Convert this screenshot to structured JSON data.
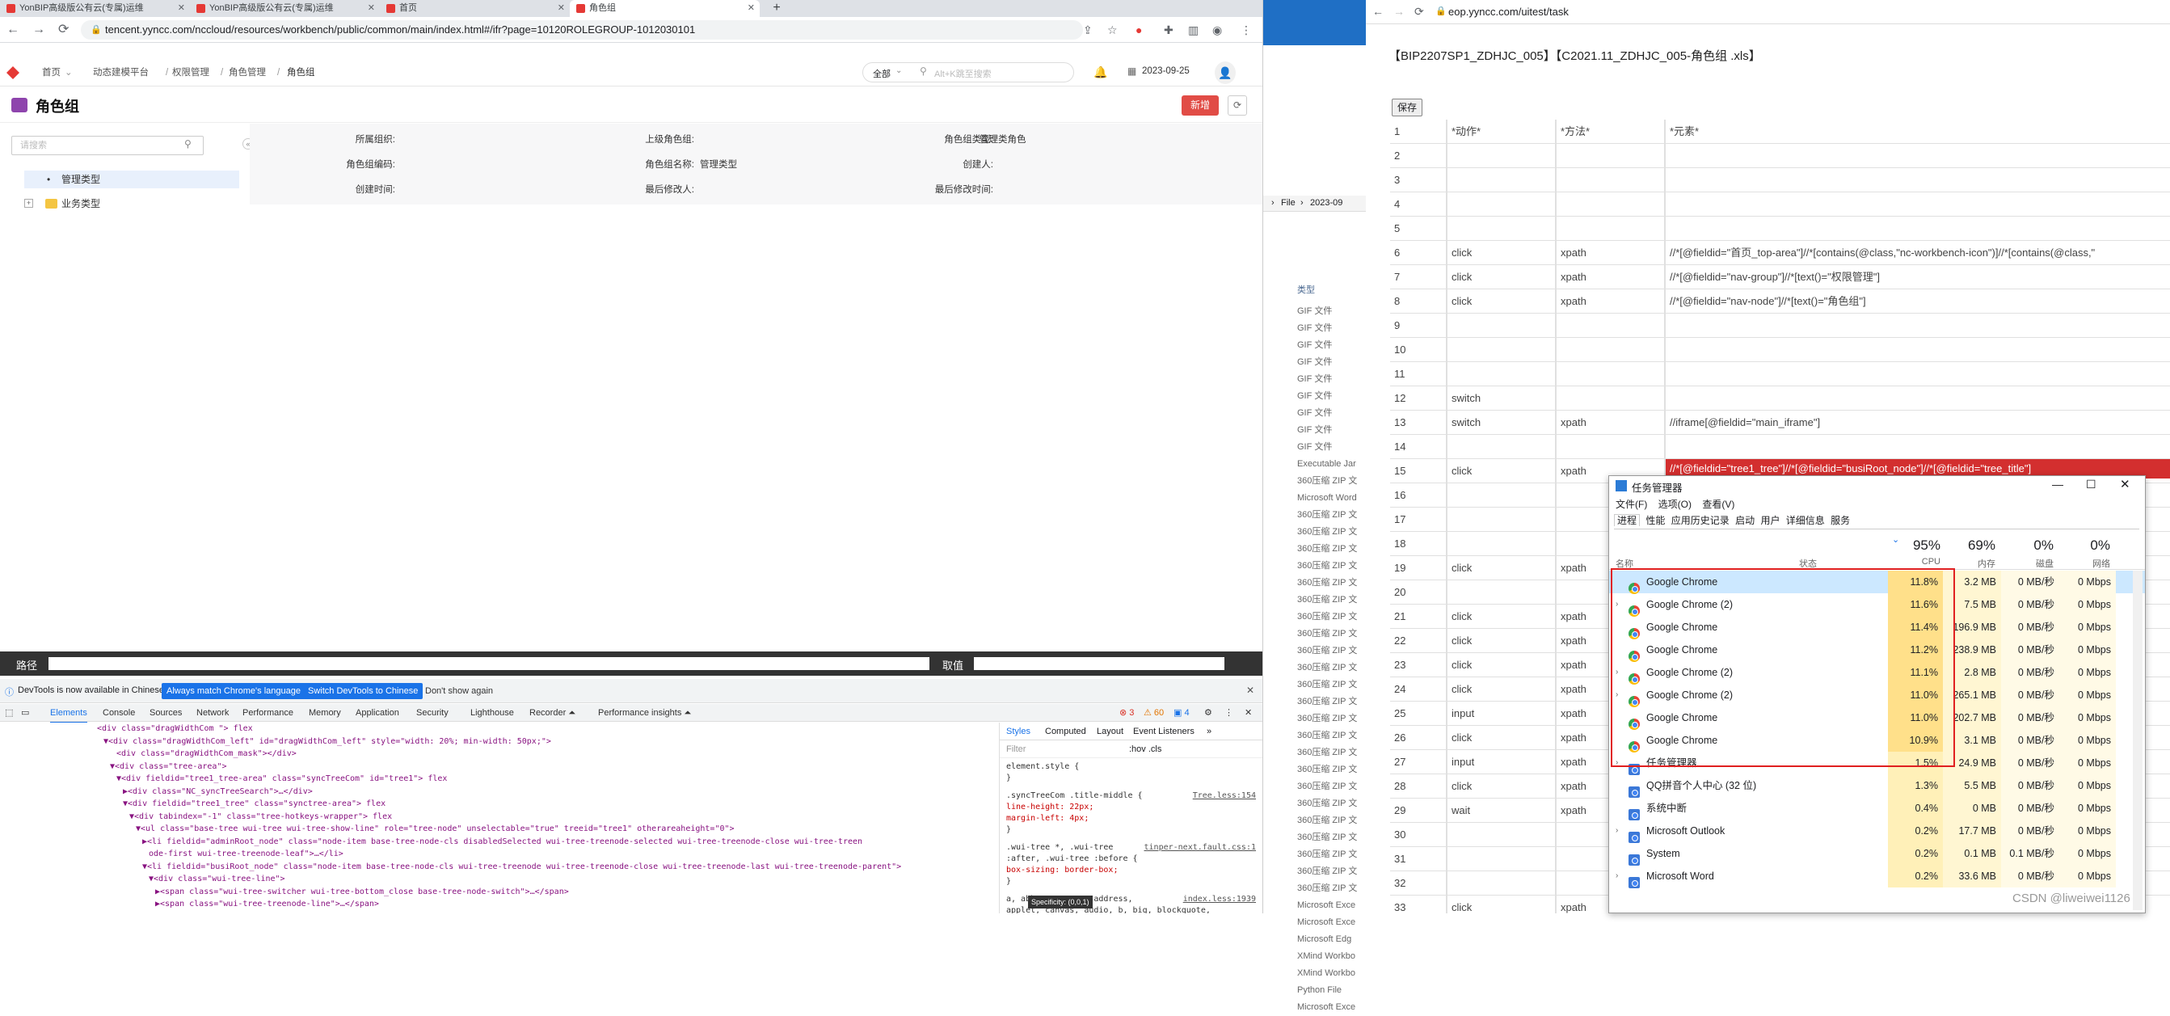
{
  "left_browser": {
    "tabs": [
      {
        "label": "YonBIP高级版公有云(专属)运维",
        "color": "#e53935"
      },
      {
        "label": "YonBIP高级版公有云(专属)运维",
        "color": "#e53935"
      },
      {
        "label": "首页",
        "color": "#e53935"
      },
      {
        "label": "角色组",
        "color": "#e53935"
      }
    ],
    "new_tab": "+",
    "url": "tencent.yyncc.com/nccloud/resources/workbench/public/common/main/index.html#/ifr?page=10120ROLEGROUP-1012030101"
  },
  "app_header": {
    "breadcrumb": [
      "首页",
      "动态建模平台",
      "权限管理",
      "角色管理",
      "角色组"
    ],
    "search_scope": "全部",
    "search_placeholder": "Alt+K跳至搜索",
    "date": "2023-09-25"
  },
  "page": {
    "title": "角色组",
    "new_button": "新增",
    "tree_search_placeholder": "请搜索",
    "tree": [
      {
        "label": "管理类型",
        "selected": true
      },
      {
        "label": "业务类型",
        "selected": false
      }
    ],
    "form": [
      {
        "label": "所属组织:",
        "value": ""
      },
      {
        "label": "上级角色组:",
        "value": ""
      },
      {
        "label": "角色组类型:",
        "value": "管理类角色"
      },
      {
        "label": "角色组编码:",
        "value": ""
      },
      {
        "label": "角色组名称:",
        "value": "管理类型"
      },
      {
        "label": "创建人:",
        "value": ""
      },
      {
        "label": "创建时间:",
        "value": ""
      },
      {
        "label": "最后修改人:",
        "value": ""
      },
      {
        "label": "最后修改时间:",
        "value": ""
      }
    ]
  },
  "bottom_strip": {
    "path_label": "路径",
    "value_label": "取值"
  },
  "devtools": {
    "info": "DevTools is now available in Chinese!",
    "btn_match": "Always match Chrome's language",
    "btn_switch": "Switch DevTools to Chinese",
    "btn_dont": "Don't show again",
    "tabs": [
      "Elements",
      "Console",
      "Sources",
      "Network",
      "Performance",
      "Memory",
      "Application",
      "Security",
      "Lighthouse",
      "Recorder ⏶",
      "Performance insights ⏶"
    ],
    "errors": "3",
    "warnings": "60",
    "issues": "4",
    "code": [
      "<div class=\"dragWidthCom \"> flex",
      "▼<div class=\"dragWidthCom_left\" id=\"dragWidthCom_left\" style=\"width: 20%; min-width: 50px;\">",
      "<div class=\"dragWidthCom_mask\"></div>",
      "▼<div class=\"tree-area\">",
      "▼<div fieldid=\"tree1_tree-area\" class=\"syncTreeCom\" id=\"tree1\"> flex",
      "▶<div class=\"NC_syncTreeSearch\">…</div>",
      "▼<div fieldid=\"tree1_tree\" class=\"synctree-area\"> flex",
      "▼<div tabindex=\"-1\" class=\"tree-hotkeys-wrapper\"> flex",
      "▼<ul class=\"base-tree wui-tree wui-tree-show-line\" role=\"tree-node\" unselectable=\"true\" treeid=\"tree1\" otherareaheight=\"0\">",
      "▶<li fieldid=\"adminRoot_node\" class=\"node-item base-tree-node-cls disabledSelected wui-tree-treenode-selected wui-tree-treenode-close wui-tree-treen",
      "ode-first wui-tree-treenode-leaf\">…</li>",
      "▼<li fieldid=\"busiRoot_node\" class=\"node-item base-tree-node-cls wui-tree-treenode wui-tree-treenode-close wui-tree-treenode-last wui-tree-treenode-parent\">",
      "▼<div class=\"wui-tree-line\">",
      "▶<span class=\"wui-tree-switcher wui-tree-bottom_close base-tree-node-switch\">…</span>",
      "▶<span class=\"wui-tree-treenode-line\">…</span>"
    ],
    "styles_tabs": [
      "Styles",
      "Computed",
      "Layout",
      "Event Listeners",
      "»"
    ],
    "filter": "Filter",
    "hov": ":hov .cls",
    "rules": [
      "element.style {",
      "}",
      ".syncTreeCom .title-middle {",
      "  line-height: 22px;",
      "  margin-left: 4px;",
      "}",
      ".wui-tree *, .wui-tree",
      ":after, .wui-tree :before {",
      "  box-sizing: border-box;",
      "}",
      "a, abbr, acronym, address,",
      "applet, canvas, audio, b, big, blockquote,"
    ],
    "rule_src": [
      "Tree.less:154",
      "tinper-next.fault.css:1",
      "index.less:1939"
    ],
    "specificity": "Specificity: (0,0,1)"
  },
  "middle_panel": {
    "breadcrumb": [
      "File",
      "2023-09"
    ],
    "header": "类型",
    "items": [
      "GIF 文件",
      "GIF 文件",
      "GIF 文件",
      "GIF 文件",
      "GIF 文件",
      "GIF 文件",
      "GIF 文件",
      "GIF 文件",
      "GIF 文件",
      "Executable Jar",
      "360压缩 ZIP 文",
      "Microsoft Word",
      "360压缩 ZIP 文",
      "360压缩 ZIP 文",
      "360压缩 ZIP 文",
      "360压缩 ZIP 文",
      "360压缩 ZIP 文",
      "360压缩 ZIP 文",
      "360压缩 ZIP 文",
      "360压缩 ZIP 文",
      "360压缩 ZIP 文",
      "360压缩 ZIP 文",
      "360压缩 ZIP 文",
      "360压缩 ZIP 文",
      "360压缩 ZIP 文",
      "360压缩 ZIP 文",
      "360压缩 ZIP 文",
      "360压缩 ZIP 文",
      "360压缩 ZIP 文",
      "360压缩 ZIP 文",
      "360压缩 ZIP 文",
      "360压缩 ZIP 文",
      "360压缩 ZIP 文",
      "360压缩 ZIP 文",
      "360压缩 ZIP 文",
      "Microsoft Exce",
      "Microsoft Exce",
      "Microsoft Edg",
      "XMind Workbo",
      "XMind Workbo",
      "Python File",
      "Microsoft Exce"
    ]
  },
  "right_browser": {
    "url": "eop.yyncc.com/uitest/task",
    "doc_title": "【BIP2207SP1_ZDHJC_005】【C2021.11_ZDHJC_005-角色组 .xls】",
    "save": "保存",
    "headers": [
      "",
      "*动作*",
      "*方法*",
      "*元素*"
    ],
    "rows": [
      [
        "1",
        "*动作*",
        "*方法*",
        "*元素*"
      ],
      [
        "2",
        "",
        "",
        ""
      ],
      [
        "3",
        "",
        "",
        ""
      ],
      [
        "4",
        "",
        "",
        ""
      ],
      [
        "5",
        "",
        "",
        ""
      ],
      [
        "6",
        "click",
        "xpath",
        "//*[@fieldid=\"首页_top-area\"]//*[contains(@class,\"nc-workbench-icon\")]//*[contains(@class,\""
      ],
      [
        "7",
        "click",
        "xpath",
        "//*[@fieldid=\"nav-group\"]//*[text()=\"权限管理\"]"
      ],
      [
        "8",
        "click",
        "xpath",
        "//*[@fieldid=\"nav-node\"]//*[text()=\"角色组\"]"
      ],
      [
        "9",
        "",
        "",
        ""
      ],
      [
        "10",
        "",
        "",
        ""
      ],
      [
        "11",
        "",
        "",
        ""
      ],
      [
        "12",
        "switch",
        "",
        ""
      ],
      [
        "13",
        "switch",
        "xpath",
        "//iframe[@fieldid=\"main_iframe\"]"
      ],
      [
        "14",
        "",
        "",
        ""
      ],
      [
        "15",
        "click",
        "xpath",
        "//*[@fieldid=\"tree1_tree\"]//*[@fieldid=\"busiRoot_node\"]//*[@fieldid=\"tree_title\"]"
      ],
      [
        "16",
        "",
        "",
        ""
      ],
      [
        "17",
        "",
        "",
        ""
      ],
      [
        "18",
        "",
        "",
        ""
      ],
      [
        "19",
        "click",
        "xpath",
        ""
      ],
      [
        "20",
        "",
        "",
        ""
      ],
      [
        "21",
        "click",
        "xpath",
        ""
      ],
      [
        "22",
        "click",
        "xpath",
        ""
      ],
      [
        "23",
        "click",
        "xpath",
        ""
      ],
      [
        "24",
        "click",
        "xpath",
        ""
      ],
      [
        "25",
        "input",
        "xpath",
        ""
      ],
      [
        "26",
        "click",
        "xpath",
        ""
      ],
      [
        "27",
        "input",
        "xpath",
        ""
      ],
      [
        "28",
        "click",
        "xpath",
        ""
      ],
      [
        "29",
        "wait",
        "xpath",
        ""
      ],
      [
        "30",
        "",
        "",
        ""
      ],
      [
        "31",
        "",
        "",
        ""
      ],
      [
        "32",
        "",
        "",
        ""
      ],
      [
        "33",
        "click",
        "xpath",
        ""
      ]
    ]
  },
  "task_manager": {
    "title": "任务管理器",
    "menu": [
      "文件(F)",
      "选项(O)",
      "查看(V)"
    ],
    "tabs": [
      "进程",
      "性能",
      "应用历史记录",
      "启动",
      "用户",
      "详细信息",
      "服务"
    ],
    "summary": {
      "cpu": "95%",
      "memory": "69%",
      "disk": "0%",
      "network": "0%"
    },
    "col_headers": {
      "name": "名称",
      "status": "状态",
      "cpu": "CPU",
      "memory": "内存",
      "disk": "磁盘",
      "network": "网络"
    },
    "processes": [
      {
        "name": "Google Chrome",
        "cpu": "11.8%",
        "mem": "3.2 MB",
        "disk": "0 MB/秒",
        "net": "0 Mbps",
        "expand": false
      },
      {
        "name": "Google Chrome (2)",
        "cpu": "11.6%",
        "mem": "7.5 MB",
        "disk": "0 MB/秒",
        "net": "0 Mbps",
        "expand": true
      },
      {
        "name": "Google Chrome",
        "cpu": "11.4%",
        "mem": "196.9 MB",
        "disk": "0 MB/秒",
        "net": "0 Mbps",
        "expand": false
      },
      {
        "name": "Google Chrome",
        "cpu": "11.2%",
        "mem": "238.9 MB",
        "disk": "0 MB/秒",
        "net": "0 Mbps",
        "expand": false
      },
      {
        "name": "Google Chrome (2)",
        "cpu": "11.1%",
        "mem": "2.8 MB",
        "disk": "0 MB/秒",
        "net": "0 Mbps",
        "expand": true
      },
      {
        "name": "Google Chrome (2)",
        "cpu": "11.0%",
        "mem": "265.1 MB",
        "disk": "0 MB/秒",
        "net": "0 Mbps",
        "expand": true
      },
      {
        "name": "Google Chrome",
        "cpu": "11.0%",
        "mem": "202.7 MB",
        "disk": "0 MB/秒",
        "net": "0 Mbps",
        "expand": false
      },
      {
        "name": "Google Chrome",
        "cpu": "10.9%",
        "mem": "3.1 MB",
        "disk": "0 MB/秒",
        "net": "0 Mbps",
        "expand": false
      },
      {
        "name": "任务管理器",
        "cpu": "1.5%",
        "mem": "24.9 MB",
        "disk": "0 MB/秒",
        "net": "0 Mbps",
        "expand": true
      },
      {
        "name": "QQ拼音个人中心 (32 位)",
        "cpu": "1.3%",
        "mem": "5.5 MB",
        "disk": "0 MB/秒",
        "net": "0 Mbps",
        "expand": false
      },
      {
        "name": "系统中断",
        "cpu": "0.4%",
        "mem": "0 MB",
        "disk": "0 MB/秒",
        "net": "0 Mbps",
        "expand": false
      },
      {
        "name": "Microsoft Outlook",
        "cpu": "0.2%",
        "mem": "17.7 MB",
        "disk": "0 MB/秒",
        "net": "0 Mbps",
        "expand": true
      },
      {
        "name": "System",
        "cpu": "0.2%",
        "mem": "0.1 MB",
        "disk": "0.1 MB/秒",
        "net": "0 Mbps",
        "expand": false
      },
      {
        "name": "Microsoft Word",
        "cpu": "0.2%",
        "mem": "33.6 MB",
        "disk": "0 MB/秒",
        "net": "0 Mbps",
        "expand": true
      }
    ]
  },
  "watermark": "CSDN @liweiwei1126",
  "colors": {
    "red_btn": "#e14c46",
    "highlight_box": "#e02020",
    "cpu_heat": "#fff4c4",
    "cpu_heat_strong": "#ffe9a0",
    "blue_link": "#1a73e8"
  }
}
